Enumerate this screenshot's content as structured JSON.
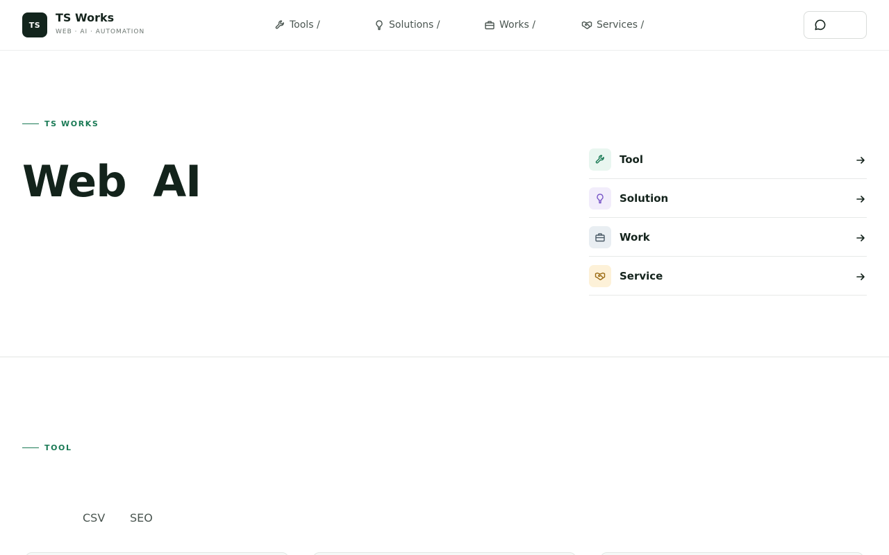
{
  "brand": {
    "logo_text": "TS",
    "name": "TS Works",
    "tagline": "WEB · AI · AUTOMATION"
  },
  "nav": [
    {
      "label": "Tools /",
      "icon": "wrench-icon"
    },
    {
      "label": "Solutions /",
      "icon": "lightbulb-icon"
    },
    {
      "label": "Works /",
      "icon": "briefcase-icon"
    },
    {
      "label": "Services /",
      "icon": "handshake-icon"
    }
  ],
  "chat_button": {
    "icon": "chat-bubble-icon"
  },
  "hero": {
    "eyebrow": "TS WORKS",
    "title": "Web AI",
    "items": [
      {
        "label": "Tool",
        "icon": "wrench-icon",
        "color": "#1a7a55",
        "bg": "#e9f6f0"
      },
      {
        "label": "Solution",
        "icon": "lightbulb-icon",
        "color": "#7a58c8",
        "bg": "#f2edfb"
      },
      {
        "label": "Work",
        "icon": "briefcase-icon",
        "color": "#4a5a66",
        "bg": "#e9eef2"
      },
      {
        "label": "Service",
        "icon": "handshake-icon",
        "color": "#9a6a12",
        "bg": "#fdf1d8"
      }
    ]
  },
  "tool_section": {
    "eyebrow": "TOOL",
    "filters": [
      "CSV",
      "SEO"
    ]
  },
  "colors": {
    "accent": "#1a7a55",
    "dark": "#13251d"
  }
}
